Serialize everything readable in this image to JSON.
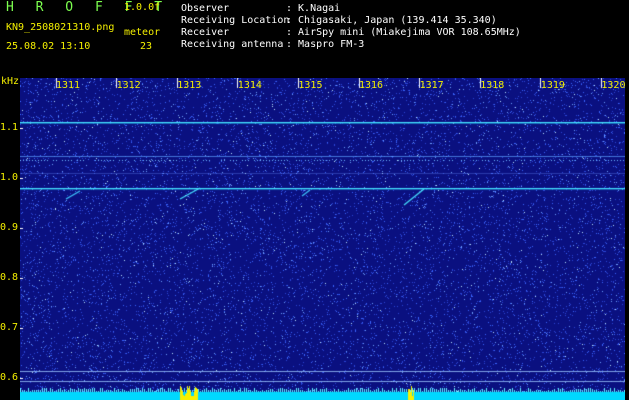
{
  "header": {
    "app_title": "H R O F F T",
    "version": "1.0.0f",
    "filename": "KN9_2508021310.png",
    "kind": "meteor",
    "timestamp": "25.08.02 13:10",
    "count": "23"
  },
  "meta": [
    {
      "label": "Observer",
      "value": ": K.Nagai"
    },
    {
      "label": "Receiving Location",
      "value": ": Chigasaki, Japan (139.414 35.340)"
    },
    {
      "label": "Receiver",
      "value": ": AirSpy mini (Miakejima VOR 108.65MHz)"
    },
    {
      "label": "Receiving antenna",
      "value": ": Maspro FM-3"
    }
  ],
  "axis": {
    "y_unit": "kHz",
    "y_ticks": [
      "1.1",
      "1.0",
      "0.9",
      "0.8",
      "0.7",
      "0.6"
    ],
    "x_ticks": [
      "1311",
      "1312",
      "1313",
      "1314",
      "1315",
      "1316",
      "1317",
      "1318",
      "1319",
      "1320"
    ]
  },
  "colors": {
    "background": "#0A1080",
    "noise": "#3A66FF",
    "signal": "#46E2FF",
    "baseline": "#00D8FF",
    "burst": "#F8F000",
    "text_green": "#7CFF4F",
    "text_yellow": "#F4F000"
  }
}
